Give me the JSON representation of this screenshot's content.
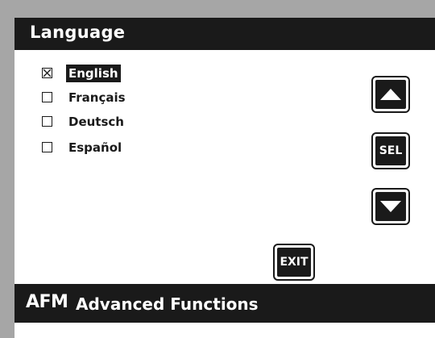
{
  "title": "Language",
  "languages": [
    {
      "label": "English",
      "selected": true
    },
    {
      "label": "Français",
      "selected": false
    },
    {
      "label": "Deutsch",
      "selected": false
    },
    {
      "label": "Español",
      "selected": false
    }
  ],
  "buttons": {
    "up_icon": "triangle-up-icon",
    "sel_label": "SEL",
    "down_icon": "triangle-down-icon",
    "exit_label": "EXIT"
  },
  "footer": {
    "logo": "AFM",
    "name": "Advanced Functions"
  },
  "colors": {
    "background": "#ffffff",
    "bars": "#1a1a1a",
    "frame": "#a6a6a6",
    "text_on_dark": "#ffffff"
  }
}
